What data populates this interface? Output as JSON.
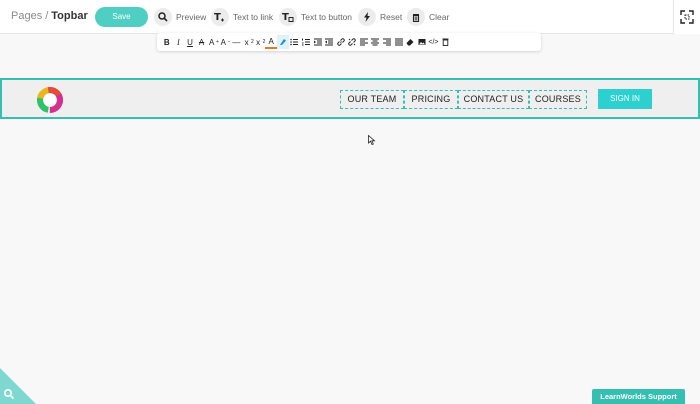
{
  "breadcrumb": {
    "parent": "Pages",
    "separator": "/",
    "current": "Topbar"
  },
  "toolbar": {
    "save_label": "Save",
    "preview_label": "Preview",
    "text_to_link_label": "Text to link",
    "text_to_button_label": "Text to button",
    "reset_label": "Reset",
    "clear_label": "Clear"
  },
  "format_toolbar": {
    "icons": [
      "bold-icon",
      "italic-icon",
      "underline-icon",
      "strikethrough-icon",
      "font-size-up-icon",
      "font-size-down-icon",
      "horizontal-rule-icon",
      "subscript-icon",
      "superscript-icon",
      "text-color-icon",
      "highlight-icon",
      "bulleted-list-icon",
      "numbered-list-icon",
      "indent-icon",
      "outdent-icon",
      "link-icon",
      "unlink-icon",
      "align-left-icon",
      "align-center-icon",
      "align-right-icon",
      "align-justify-icon",
      "eraser-icon",
      "image-icon",
      "code-icon",
      "trash-icon"
    ],
    "glyphs": {
      "bold": "B",
      "italic": "I",
      "underline": "U",
      "strike": "A",
      "size_up": "A",
      "size_down": "A",
      "sub": "x",
      "sup": "x",
      "color": "A"
    }
  },
  "header": {
    "nav": [
      {
        "label": "OUR TEAM"
      },
      {
        "label": "PRICING"
      },
      {
        "label": "CONTACT US"
      },
      {
        "label": "COURSES"
      }
    ],
    "signin_label": "SIGN IN"
  },
  "support_label": "LearnWorlds Support",
  "colors": {
    "accent": "#34bfb1",
    "save": "#4fcfc4",
    "signin": "#2bd0cf"
  }
}
